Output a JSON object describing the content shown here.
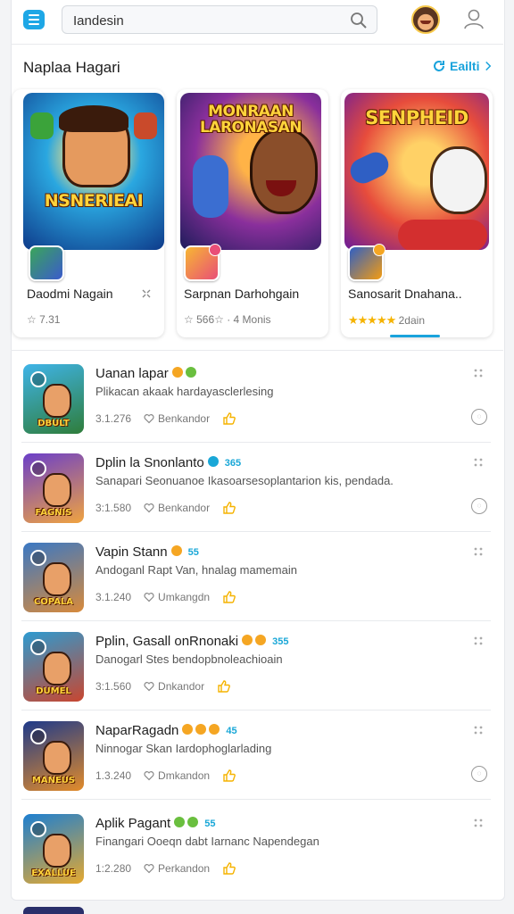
{
  "search": {
    "value": "Iandesin"
  },
  "section": {
    "title": "Naplaa Hagari",
    "see_all": "Eailti"
  },
  "featured": [
    {
      "title": "Daodmi Nagain",
      "rating": "☆ 7.31",
      "art_text": "NSNERIEAI",
      "stars": ""
    },
    {
      "title": "Sarpnan Darhohgain",
      "rating": "☆ 566☆ · 4 Monis",
      "art_text": "MONRAAN LARONASAN",
      "stars": ""
    },
    {
      "title": "Sanosarit Dnahana..",
      "rating": "2dain",
      "art_text": "SENPHEID",
      "stars": "★★★★★"
    }
  ],
  "list": [
    {
      "name": "Uanan lapar",
      "desc": "Plikacan akaak hardayasclerlesing",
      "version": "3.1.276",
      "label": "Benkandor",
      "thumb_text": "DBULT",
      "badges": [
        "#f5a623",
        "#6abf3f"
      ],
      "tag": "",
      "circle": ""
    },
    {
      "name": "Dplin la Snonlanto",
      "desc": "Sanapari Seonuanoe Ikasoarsesoplantarion kis, pendada.",
      "version": "3:1.580",
      "label": "Benkandor",
      "thumb_text": "FAGNIS",
      "badges": [
        "#19a7d7"
      ],
      "tag": "365",
      "circle": ""
    },
    {
      "name": "Vapin Stann",
      "desc": "Andoganl Rapt Van, hnalag mamemain",
      "version": "3.1.240",
      "label": "Umkangdn",
      "thumb_text": "COPALA",
      "badges": [
        "#f5a623"
      ],
      "tag": "55",
      "circle": ""
    },
    {
      "name": "Pplin, Gasall onRnonaki",
      "desc": "Danogarl Stes bendopbnoleachioain",
      "version": "3:1.560",
      "label": "Dnkandor",
      "thumb_text": "DUMEL",
      "badges": [
        "#f5a623",
        "#f5a623"
      ],
      "tag": "355",
      "circle": ""
    },
    {
      "name": "NaparRagadn",
      "desc": "Ninnogar Skan Iardophoglarlading",
      "version": "1.3.240",
      "label": "Dmkandon",
      "thumb_text": "MANEUS",
      "badges": [
        "#f5a623",
        "#f5a623",
        "#f5a623"
      ],
      "tag": "45",
      "circle": ""
    },
    {
      "name": "Aplik Pagant",
      "desc": "Finangari Ooeqn dabt Iarnanc Napendegan",
      "version": "1:2.280",
      "label": "Perkandon",
      "thumb_text": "EXALLUE",
      "badges": [
        "#6abf3f",
        "#6abf3f"
      ],
      "tag": "55",
      "circle": ""
    }
  ],
  "colors": {
    "accent": "#1aa3dc",
    "star": "#f5b301"
  },
  "icons": [
    "menu-icon",
    "search-icon",
    "user-icon",
    "refresh-icon",
    "chevron-right-icon",
    "share-icon",
    "heart-icon",
    "thumbs-up-icon",
    "drag-handle-icon"
  ]
}
